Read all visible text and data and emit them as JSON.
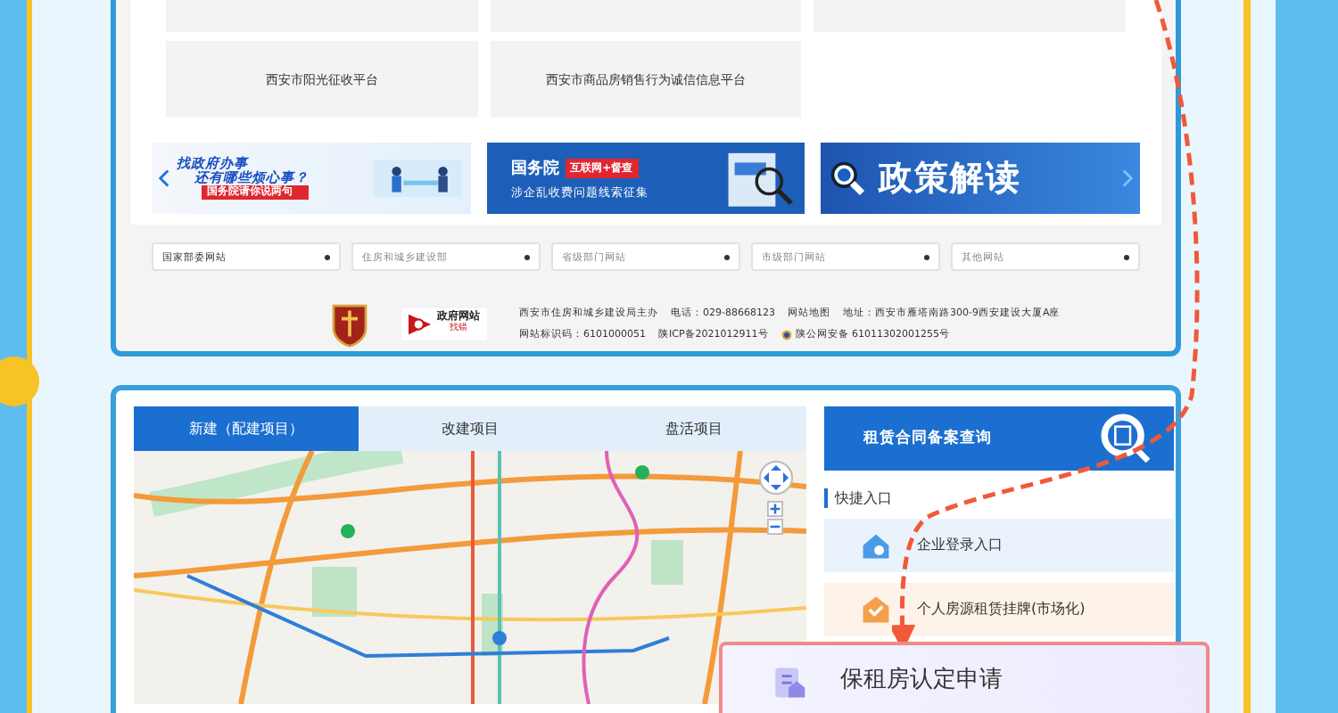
{
  "link_cards": [
    {
      "label": "西安市阳光征收平台"
    },
    {
      "label": "西安市商品房销售行为诚信信息平台"
    }
  ],
  "banners": [
    {
      "kind": "service",
      "lines": [
        "找政府办事",
        "还有哪些烦心事？",
        "国务院请你说两句"
      ]
    },
    {
      "kind": "notice",
      "lines": [
        "国务院",
        "互联网+督查",
        "涉企乱收费问题线索征集"
      ]
    },
    {
      "kind": "policy",
      "lines": [
        "政策解读"
      ]
    }
  ],
  "dropdowns": [
    {
      "label": "国家部委网站"
    },
    {
      "label": "住房和城乡建设部"
    },
    {
      "label": "省级部门网站"
    },
    {
      "label": "市级部门网站"
    },
    {
      "label": "其他网站"
    }
  ],
  "footer": {
    "gov_logo": {
      "title": "政府网站",
      "sub": "找错"
    },
    "org": "西安市住房和城乡建设局主办",
    "phone": "电话：029-88668123",
    "sitemap": "网站地图",
    "address": "地址：西安市雁塔南路300-9西安建设大厦A座",
    "site_code": "网站标识码：6101000051",
    "icp": "陕ICP备2021012911号",
    "police": "陕公网安备 61011302001255号"
  },
  "map_tabs": [
    {
      "label": "新建（配建项目）",
      "selected": true
    },
    {
      "label": "改建项目",
      "selected": false
    },
    {
      "label": "盘活项目",
      "selected": false
    }
  ],
  "query_button": "租赁合同备案查询",
  "quick_title": "快捷入口",
  "quick_links": [
    {
      "kind": "company",
      "label": "企业登录入口"
    },
    {
      "kind": "personal",
      "label": "个人房源租赁挂牌(市场化)"
    }
  ],
  "overlay_card": {
    "label": "保租房认定申请"
  }
}
